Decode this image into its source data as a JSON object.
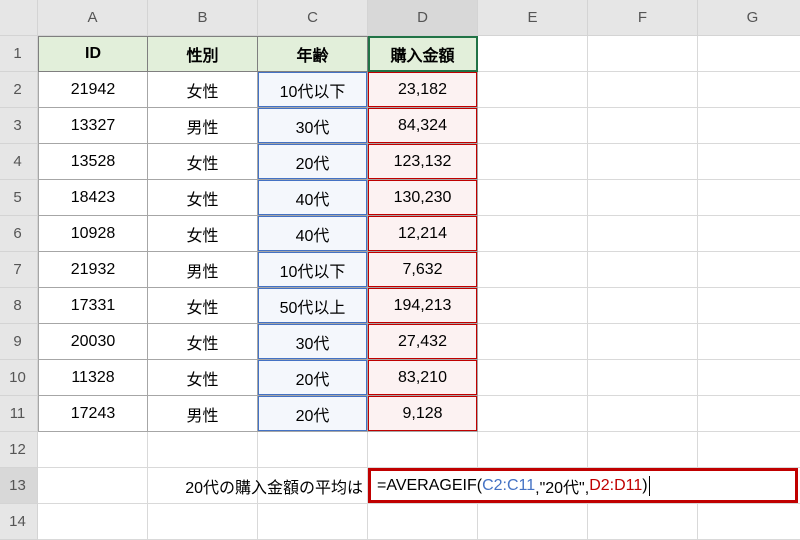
{
  "columns": [
    "A",
    "B",
    "C",
    "D",
    "E",
    "F",
    "G"
  ],
  "row_count": 14,
  "selected_column": "D",
  "selected_row": 13,
  "headers": {
    "A": "ID",
    "B": "性別",
    "C": "年齢",
    "D": "購入金額"
  },
  "rows": [
    {
      "id": "21942",
      "gender": "女性",
      "age": "10代以下",
      "amount": "23,182"
    },
    {
      "id": "13327",
      "gender": "男性",
      "age": "30代",
      "amount": "84,324"
    },
    {
      "id": "13528",
      "gender": "女性",
      "age": "20代",
      "amount": "123,132"
    },
    {
      "id": "18423",
      "gender": "女性",
      "age": "40代",
      "amount": "130,230"
    },
    {
      "id": "10928",
      "gender": "女性",
      "age": "40代",
      "amount": "12,214"
    },
    {
      "id": "21932",
      "gender": "男性",
      "age": "10代以下",
      "amount": "7,632"
    },
    {
      "id": "17331",
      "gender": "女性",
      "age": "50代以上",
      "amount": "194,213"
    },
    {
      "id": "20030",
      "gender": "女性",
      "age": "30代",
      "amount": "27,432"
    },
    {
      "id": "11328",
      "gender": "女性",
      "age": "20代",
      "amount": "83,210"
    },
    {
      "id": "17243",
      "gender": "男性",
      "age": "20代",
      "amount": "9,128"
    }
  ],
  "label_row13": "20代の購入金額の平均は",
  "formula": {
    "prefix": "=AVERAGEIF(",
    "range1": "C2:C11",
    "sep1": ",\"20代\",",
    "range2": "D2:D11",
    "suffix": ")"
  },
  "chart_data": {
    "type": "table",
    "title": "",
    "columns": [
      "ID",
      "性別",
      "年齢",
      "購入金額"
    ],
    "rows": [
      [
        21942,
        "女性",
        "10代以下",
        23182
      ],
      [
        13327,
        "男性",
        "30代",
        84324
      ],
      [
        13528,
        "女性",
        "20代",
        123132
      ],
      [
        18423,
        "女性",
        "40代",
        130230
      ],
      [
        10928,
        "女性",
        "40代",
        12214
      ],
      [
        21932,
        "男性",
        "10代以下",
        7632
      ],
      [
        17331,
        "女性",
        "50代以上",
        194213
      ],
      [
        20030,
        "女性",
        "30代",
        27432
      ],
      [
        11328,
        "女性",
        "20代",
        83210
      ],
      [
        17243,
        "男性",
        "20代",
        9128
      ]
    ],
    "formula_cell": "D13",
    "formula": "=AVERAGEIF(C2:C11,\"20代\",D2:D11)"
  }
}
